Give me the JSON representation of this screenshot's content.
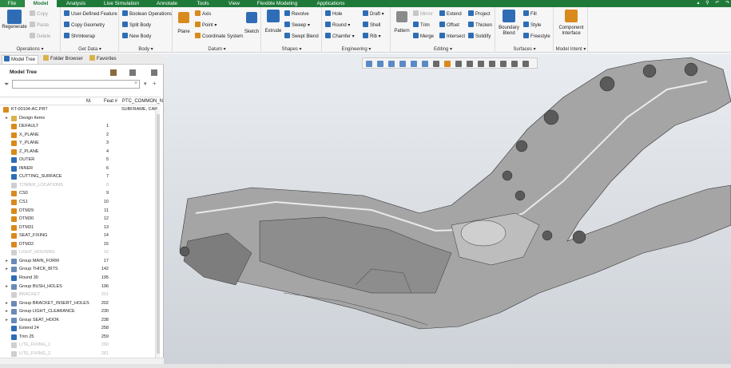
{
  "tabs": [
    "File",
    "Model",
    "Analysis",
    "Live Simulation",
    "Annotate",
    "Tools",
    "View",
    "Flexible Modeling",
    "Applications"
  ],
  "active_tab": "Model",
  "ribbon": {
    "operations": {
      "regenerate": "Regenerate",
      "copy": "Copy",
      "paste": "Paste",
      "delete": "Delete",
      "label": "Operations"
    },
    "get_data": {
      "udf": "User-Defined Feature",
      "copy_geometry": "Copy Geometry",
      "shrinkwrap": "Shrinkwrap",
      "label": "Get Data"
    },
    "body": {
      "boolean": "Boolean Operations",
      "split": "Split Body",
      "new": "New Body",
      "label": "Body"
    },
    "datum": {
      "plane": "Plane",
      "axis": "Axis",
      "point": "Point",
      "csys": "Coordinate System",
      "label": "Datum"
    },
    "sketch": "Sketch",
    "shapes": {
      "extrude": "Extrude",
      "revolve": "Revolve",
      "sweep": "Sweep",
      "swept_blend": "Swept Blend",
      "label": "Shapes"
    },
    "engineering": {
      "hole": "Hole",
      "round": "Round",
      "chamfer": "Chamfer",
      "draft": "Draft",
      "shell": "Shell",
      "rib": "Rib",
      "label": "Engineering"
    },
    "editing": {
      "pattern": "Pattern",
      "mirror": "Mirror",
      "trim": "Trim",
      "merge": "Merge",
      "extend": "Extend",
      "offset": "Offset",
      "intersect": "Intersect",
      "project": "Project",
      "thicken": "Thicken",
      "solidify": "Solidify",
      "label": "Editing"
    },
    "surfaces": {
      "boundary": "Boundary",
      "blend": "Blend",
      "fill": "Fill",
      "style": "Style",
      "freestyle": "Freestyle",
      "label": "Surfaces"
    },
    "model_intent": {
      "component": "Component",
      "interface": "Interface",
      "label": "Model Intent"
    }
  },
  "nav_tabs": [
    "Model Tree",
    "Folder Browser",
    "Favorites"
  ],
  "tree": {
    "title": "Model Tree",
    "filter_placeholder": "",
    "columns": [
      "M.",
      "Feat #",
      "PTC_COMMON_N"
    ],
    "root": {
      "label": "KT-00104-AC.PRT",
      "value": "SUBFRAME, CAR"
    },
    "rows": [
      {
        "label": "Design Items",
        "num": "",
        "icon": "folder",
        "expand": true,
        "sup": false
      },
      {
        "label": "DEFAULT",
        "num": "1",
        "icon": "csys",
        "expand": false,
        "sup": false
      },
      {
        "label": "X_PLANE",
        "num": "2",
        "icon": "plane",
        "expand": false,
        "sup": false
      },
      {
        "label": "Y_PLANE",
        "num": "3",
        "icon": "plane",
        "expand": false,
        "sup": false
      },
      {
        "label": "Z_PLANE",
        "num": "4",
        "icon": "plane",
        "expand": false,
        "sup": false
      },
      {
        "label": "OUTER",
        "num": "5",
        "icon": "sketch",
        "expand": false,
        "sup": false
      },
      {
        "label": "INNER",
        "num": "6",
        "icon": "sketch",
        "expand": false,
        "sup": false
      },
      {
        "label": "CUTTING_SURFACE",
        "num": "7",
        "icon": "sketch",
        "expand": false,
        "sup": false
      },
      {
        "label": "TOWER_LOCATIONS",
        "num": "8",
        "icon": "sketch",
        "expand": false,
        "sup": true
      },
      {
        "label": "CS0",
        "num": "9",
        "icon": "csys",
        "expand": false,
        "sup": false
      },
      {
        "label": "CS1",
        "num": "10",
        "icon": "csys",
        "expand": false,
        "sup": false
      },
      {
        "label": "DTM29",
        "num": "11",
        "icon": "plane",
        "expand": false,
        "sup": false
      },
      {
        "label": "DTM30",
        "num": "12",
        "icon": "plane",
        "expand": false,
        "sup": false
      },
      {
        "label": "DTM31",
        "num": "13",
        "icon": "plane",
        "expand": false,
        "sup": false
      },
      {
        "label": "SEAT_FIXING",
        "num": "14",
        "icon": "csys",
        "expand": false,
        "sup": false
      },
      {
        "label": "DTM32",
        "num": "15",
        "icon": "plane",
        "expand": false,
        "sup": false
      },
      {
        "label": "LIGHT_HOUSING",
        "num": "16",
        "icon": "feat",
        "expand": false,
        "sup": true
      },
      {
        "label": "Group MAIN_FORM",
        "num": "17",
        "icon": "group",
        "expand": true,
        "sup": false
      },
      {
        "label": "Group THICK_BITS",
        "num": "142",
        "icon": "group",
        "expand": true,
        "sup": false
      },
      {
        "label": "Round 30",
        "num": "195",
        "icon": "round",
        "expand": false,
        "sup": false
      },
      {
        "label": "Group BUSH_HOLES",
        "num": "196",
        "icon": "group",
        "expand": true,
        "sup": false
      },
      {
        "label": "BRACKET",
        "num": "201",
        "icon": "feat",
        "expand": false,
        "sup": true
      },
      {
        "label": "Group BRACKET_INSERT_HOLES",
        "num": "202",
        "icon": "group",
        "expand": true,
        "sup": false
      },
      {
        "label": "Group LIGHT_CLEARANCE",
        "num": "230",
        "icon": "group",
        "expand": true,
        "sup": false
      },
      {
        "label": "Group SEAT_HOOK",
        "num": "238",
        "icon": "group",
        "expand": true,
        "sup": false
      },
      {
        "label": "Extend 24",
        "num": "258",
        "icon": "feat",
        "expand": false,
        "sup": false
      },
      {
        "label": "Trim 25",
        "num": "259",
        "icon": "feat",
        "expand": false,
        "sup": false
      },
      {
        "label": "LITE_FIXING_1",
        "num": "260",
        "icon": "feat",
        "expand": false,
        "sup": true
      },
      {
        "label": "LITE_FIXING_2",
        "num": "261",
        "icon": "feat",
        "expand": false,
        "sup": true
      }
    ]
  },
  "colors": {
    "brand": "#1f7a3a",
    "ribbon_bg": "#f6f6f6",
    "icon_blue": "#2e6db5",
    "icon_green": "#3a8f3a",
    "icon_orange": "#d98a1c",
    "model_fill": "#9a9a9a"
  }
}
